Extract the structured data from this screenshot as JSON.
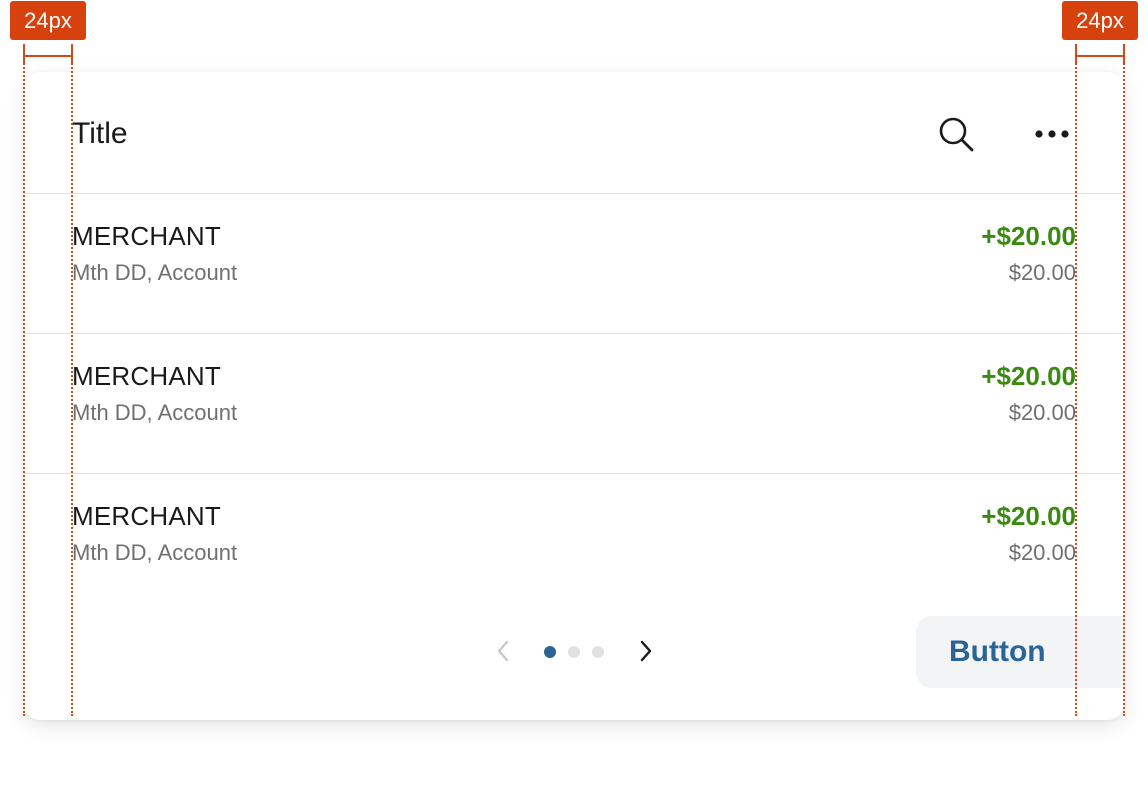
{
  "card": {
    "title": "Title",
    "header_icons": {
      "search": "search-icon",
      "more": "more-horizontal-icon"
    },
    "transactions": [
      {
        "merchant": "MERCHANT",
        "subline": "Mth DD, Account",
        "amount": "+$20.00",
        "balance": "$20.00"
      },
      {
        "merchant": "MERCHANT",
        "subline": "Mth DD, Account",
        "amount": "+$20.00",
        "balance": "$20.00"
      },
      {
        "merchant": "MERCHANT",
        "subline": "Mth DD, Account",
        "amount": "+$20.00",
        "balance": "$20.00"
      }
    ],
    "pager": {
      "pages": 3,
      "current": 1,
      "prev_icon": "chevron-left-icon",
      "next_icon": "chevron-right-icon"
    },
    "action_button_label": "Button"
  },
  "annotations": {
    "left_spacing_label": "24px",
    "right_spacing_label": "24px"
  },
  "colors": {
    "amount_positive": "#3a8a10",
    "accent": "#2a6396",
    "secondary_text": "#707070",
    "annotation": "#d7410e"
  }
}
